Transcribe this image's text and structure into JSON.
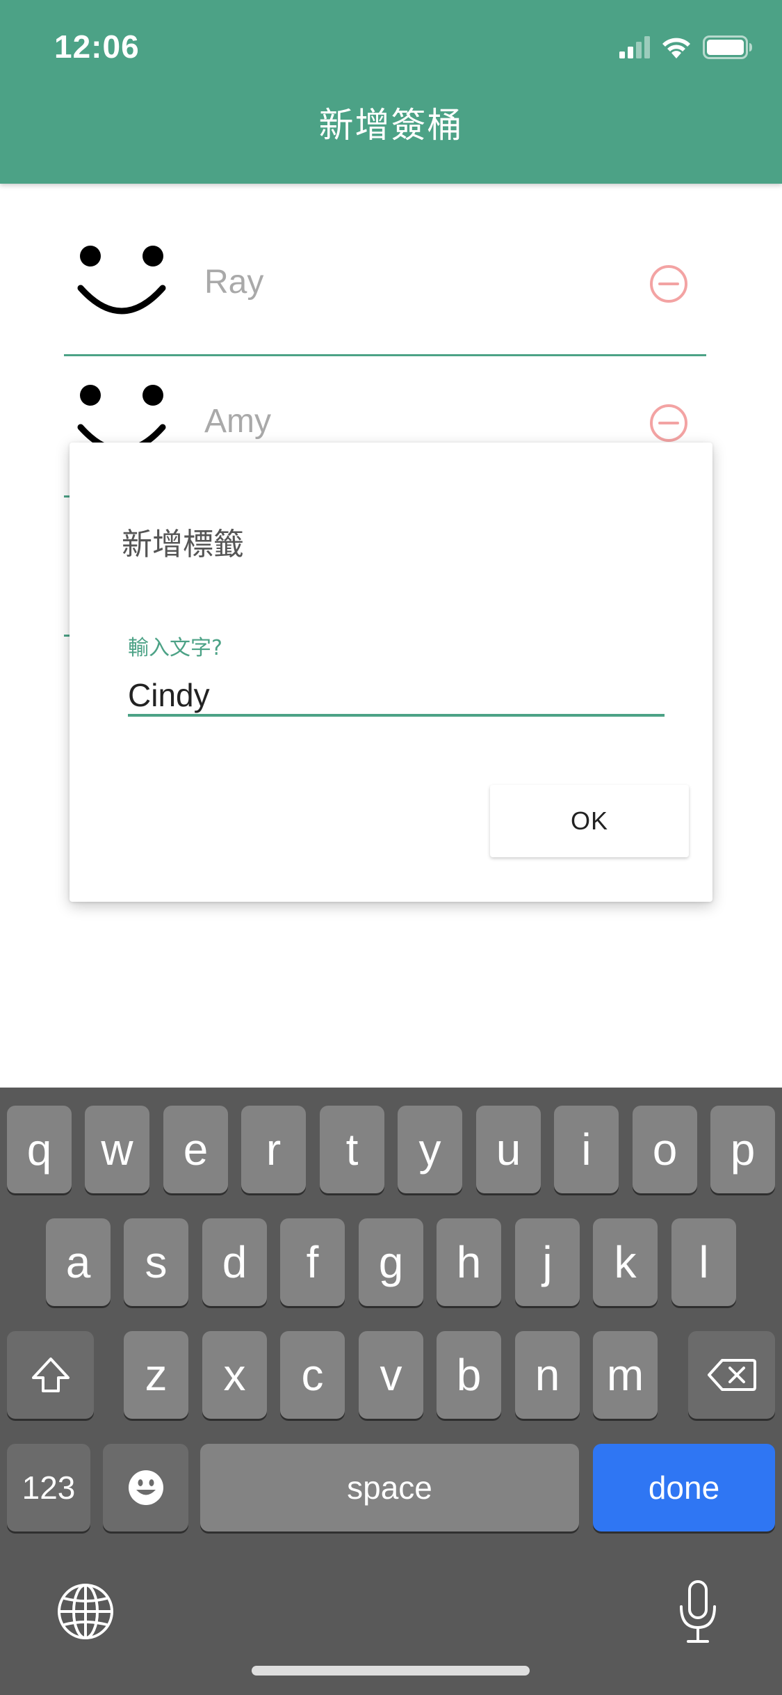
{
  "status_bar": {
    "time": "12:06",
    "signal_icon": "signal-icon",
    "wifi_icon": "wifi-icon",
    "battery_icon": "battery-icon"
  },
  "header": {
    "title": "新增簽桶"
  },
  "list": {
    "items": [
      {
        "name": "Ray",
        "avatar_icon": "smiley-face-icon",
        "action_icon": "minus-circle-icon"
      },
      {
        "name": "Amy",
        "avatar_icon": "smiley-face-icon",
        "action_icon": "minus-circle-icon"
      }
    ]
  },
  "dialog": {
    "title": "新增標籤",
    "field_label": "輸入文字?",
    "field_value": "Cindy",
    "ok_label": "OK"
  },
  "keyboard": {
    "row1": [
      "q",
      "w",
      "e",
      "r",
      "t",
      "y",
      "u",
      "i",
      "o",
      "p"
    ],
    "row2": [
      "a",
      "s",
      "d",
      "f",
      "g",
      "h",
      "j",
      "k",
      "l"
    ],
    "row3": [
      "z",
      "x",
      "c",
      "v",
      "b",
      "n",
      "m"
    ],
    "numbers_label": "123",
    "space_label": "space",
    "done_label": "done",
    "shift_icon": "shift-icon",
    "delete_icon": "backspace-icon",
    "emoji_icon": "emoji-icon",
    "globe_icon": "globe-icon",
    "mic_icon": "microphone-icon"
  },
  "colors": {
    "accent": "#4ca286",
    "remove": "#f3a3a3",
    "done": "#2f76f3"
  }
}
